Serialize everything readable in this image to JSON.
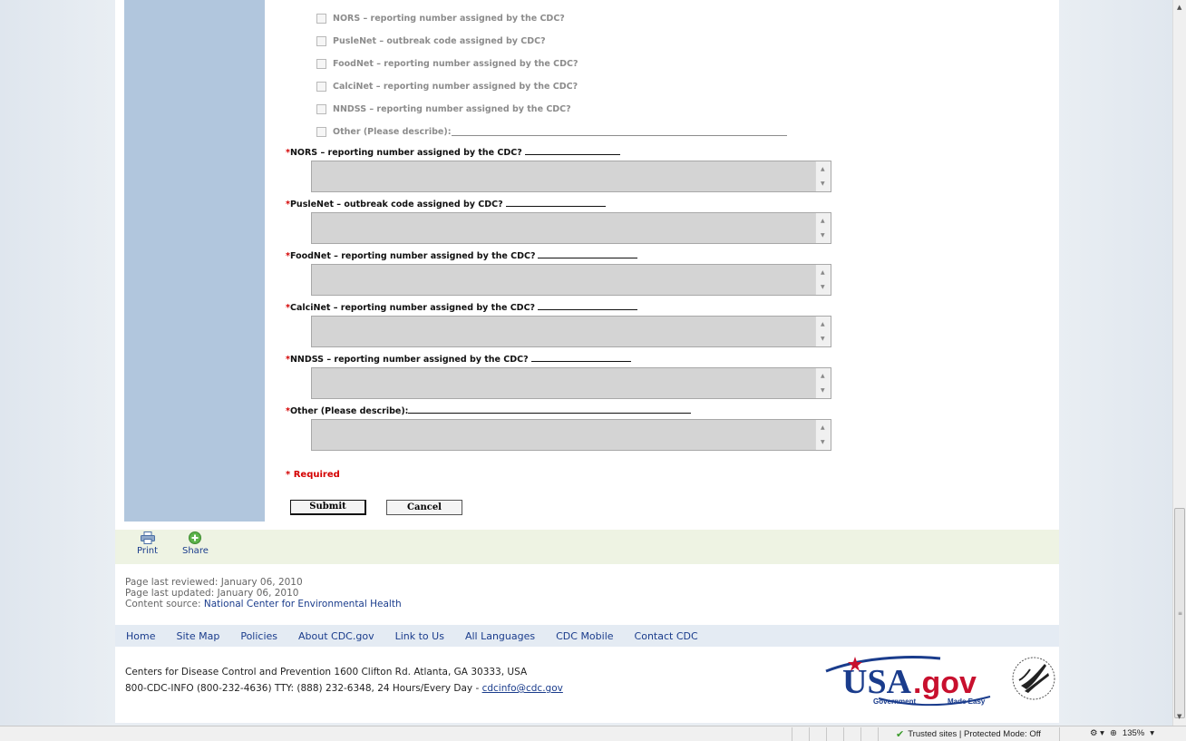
{
  "checkboxes": [
    {
      "label": "NORS – reporting number assigned by the CDC?"
    },
    {
      "label": "PusleNet – outbreak code assigned by CDC?"
    },
    {
      "label": "FoodNet – reporting number assigned by the CDC?"
    },
    {
      "label": "CalciNet – reporting number assigned by the CDC?"
    },
    {
      "label": "NNDSS – reporting number assigned by the CDC?"
    },
    {
      "label": "Other (Please describe):"
    }
  ],
  "questions": [
    {
      "label": "NORS – reporting number assigned by the CDC?"
    },
    {
      "label": "PusleNet – outbreak code assigned by CDC?"
    },
    {
      "label": "FoodNet – reporting number assigned by the CDC?"
    },
    {
      "label": "CalciNet – reporting number assigned by the CDC?"
    },
    {
      "label": "NNDSS – reporting number assigned by the CDC?"
    },
    {
      "label": "Other (Please describe):"
    }
  ],
  "required_star": "*",
  "required_note": "* Required",
  "buttons": {
    "submit": "Submit",
    "cancel": "Cancel"
  },
  "toolbar": {
    "print": "Print",
    "share": "Share"
  },
  "meta": {
    "reviewed": "Page last reviewed: January 06, 2010",
    "updated": "Page last updated: January 06, 2010",
    "source_prefix": "Content source: ",
    "source_link": "National Center for Environmental Health"
  },
  "footer_nav": [
    "Home",
    "Site Map",
    "Policies",
    "About CDC.gov",
    "Link to Us",
    "All Languages",
    "CDC Mobile",
    "Contact CDC"
  ],
  "address": {
    "line1": "Centers for Disease Control and Prevention   1600 Clifton Rd. Atlanta, GA 30333, USA",
    "line2_prefix": "800-CDC-INFO (800-232-4636) TTY: (888) 232-6348, 24 Hours/Every Day - ",
    "email": "cdcinfo@cdc.gov"
  },
  "logo": {
    "usa": "USA",
    "gov": ".gov",
    "tag_left": "Government",
    "tag_right": "Made Easy"
  },
  "statusbar": {
    "trusted": "Trusted sites | Protected Mode: Off",
    "zoom": "135%"
  },
  "colors": {
    "accent_blue": "#1a3c8c",
    "required_red": "#d40000",
    "sidebar": "#b1c6dd"
  }
}
